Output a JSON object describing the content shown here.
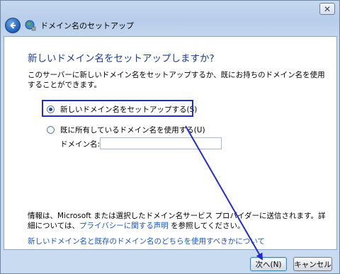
{
  "window": {
    "title": "ドメイン名のセットアップ",
    "close_label": "✕"
  },
  "main": {
    "heading": "新しいドメイン名をセットアップしますか?",
    "description": "このサーバーに新しいドメイン名をセットアップするか、既にお持ちのドメイン名を使用することができます。",
    "options": [
      {
        "label": "新しいドメイン名をセットアップする(S)",
        "selected": true
      },
      {
        "label": "既に所有しているドメイン名を使用する(U)",
        "selected": false
      }
    ],
    "domain_name_label": "ドメイン名:",
    "domain_name_value": "",
    "info_text_1": "情報は、Microsoft または選択したドメイン名サービス プロバイダーに送信されます。詳細については、",
    "privacy_link": "プライバシーに関する声明",
    "info_text_2": " を参照してください。",
    "help_link": "新しいドメイン名と既存のドメイン名のどちらを使用すべきかについて"
  },
  "footer": {
    "next_label": "次へ(N)",
    "cancel_label": "キャンセル"
  },
  "annotation": {
    "color": "#1f2bd6"
  }
}
